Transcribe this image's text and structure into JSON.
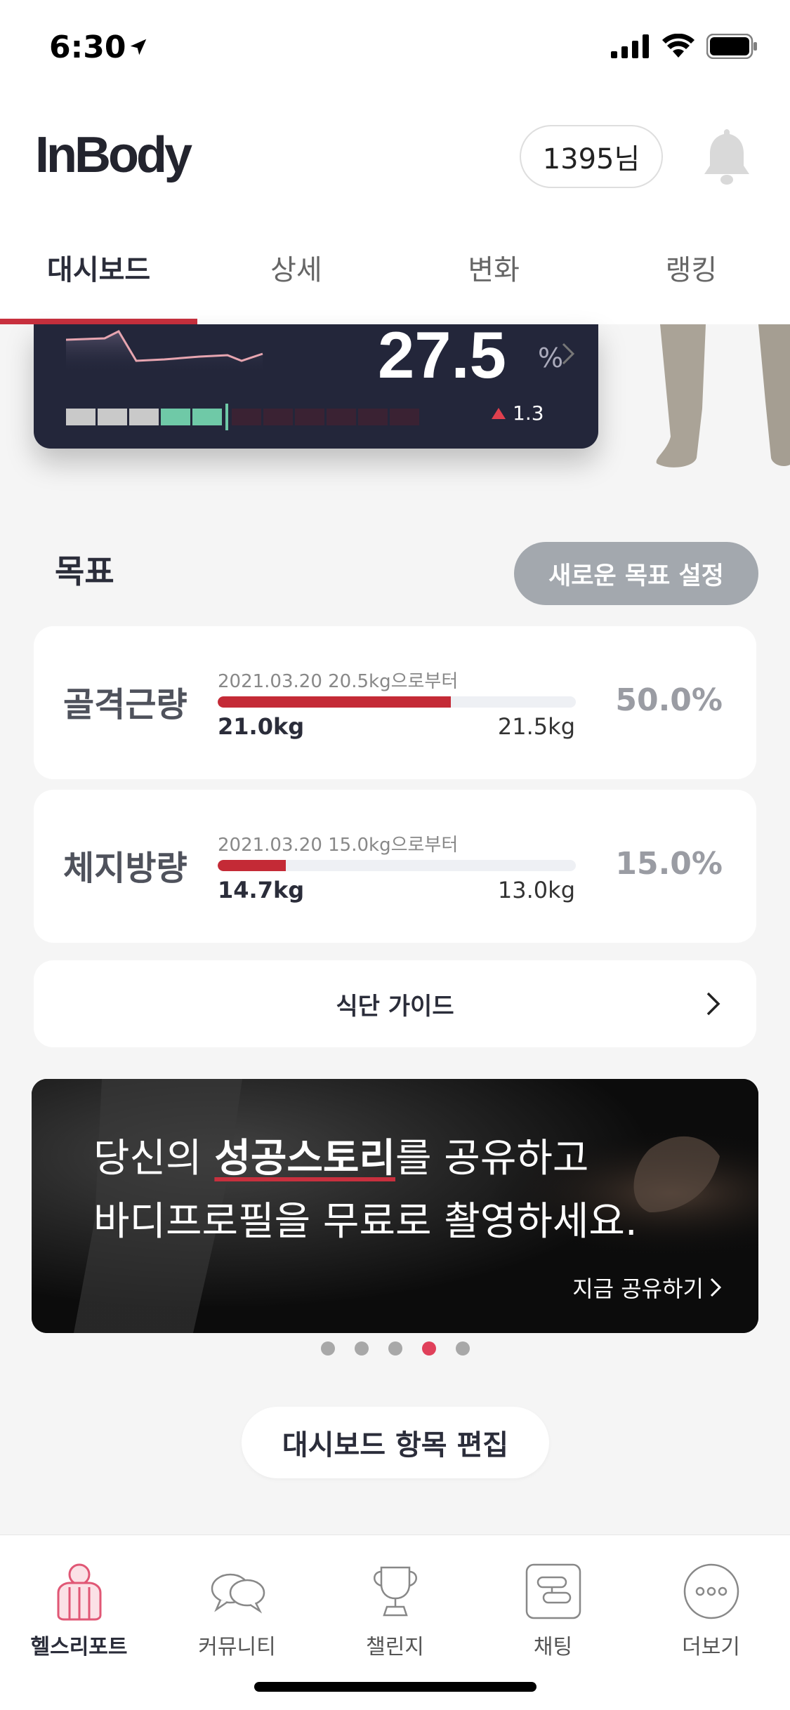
{
  "status_bar": {
    "time": "6:30"
  },
  "header": {
    "logo": "InBody",
    "user": "1395님"
  },
  "tabs": [
    {
      "label": "대시보드",
      "active": true
    },
    {
      "label": "상세",
      "active": false
    },
    {
      "label": "변화",
      "active": false
    },
    {
      "label": "랭킹",
      "active": false
    }
  ],
  "body_fat_card": {
    "value": "27.5",
    "unit": "%",
    "delta": "1.3"
  },
  "goals": {
    "title": "목표",
    "new_goal_button": "새로운 목표 설정",
    "items": [
      {
        "name": "골격근량",
        "sub": "2021.03.20 20.5kg으로부터",
        "start": "21.0kg",
        "target": "21.5kg",
        "percent": "50.0%",
        "progress": 0.65
      },
      {
        "name": "체지방량",
        "sub": "2021.03.20 15.0kg으로부터",
        "start": "14.7kg",
        "target": "13.0kg",
        "percent": "15.0%",
        "progress": 0.19
      }
    ],
    "diet_guide": "식단 가이드"
  },
  "banner": {
    "line1_pre": "당신의 ",
    "line1_em": "성공스토리",
    "line1_post": "를 공유하고",
    "line2": "바디프로필을 무료로 촬영하세요.",
    "cta": "지금 공유하기"
  },
  "carousel": {
    "count": 5,
    "active_index": 3
  },
  "edit_button": "대시보드 항목 편집",
  "bottom_nav": [
    {
      "label": "헬스리포트",
      "icon": "health-report-icon",
      "active": true
    },
    {
      "label": "커뮤니티",
      "icon": "community-icon",
      "active": false
    },
    {
      "label": "챌린지",
      "icon": "trophy-icon",
      "active": false
    },
    {
      "label": "채팅",
      "icon": "chat-icon",
      "active": false
    },
    {
      "label": "더보기",
      "icon": "more-icon",
      "active": false
    }
  ],
  "colors": {
    "accent": "#c8303e",
    "card_dark": "#23263a",
    "muted_button": "#a3a8ae"
  }
}
